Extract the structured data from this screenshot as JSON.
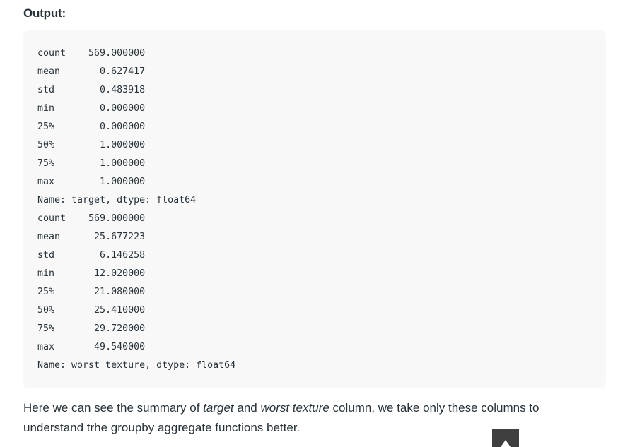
{
  "heading": "Output:",
  "code_output": [
    "count    569.000000",
    "mean       0.627417",
    "std        0.483918",
    "min        0.000000",
    "25%        0.000000",
    "50%        1.000000",
    "75%        1.000000",
    "max        1.000000",
    "Name: target, dtype: float64",
    "count    569.000000",
    "mean      25.677223",
    "std        6.146258",
    "min       12.020000",
    "25%       21.080000",
    "50%       25.410000",
    "75%       29.720000",
    "max       49.540000",
    "Name: worst texture, dtype: float64"
  ],
  "paragraph": {
    "part1": "Here we can see the summary of ",
    "em1": "target",
    "part2": " and ",
    "em2": "worst texture",
    "part3": " column, we take only these columns to understand trhe groupby aggregate functions better."
  },
  "scroll_top": {
    "icon": "arrow-up-icon"
  }
}
